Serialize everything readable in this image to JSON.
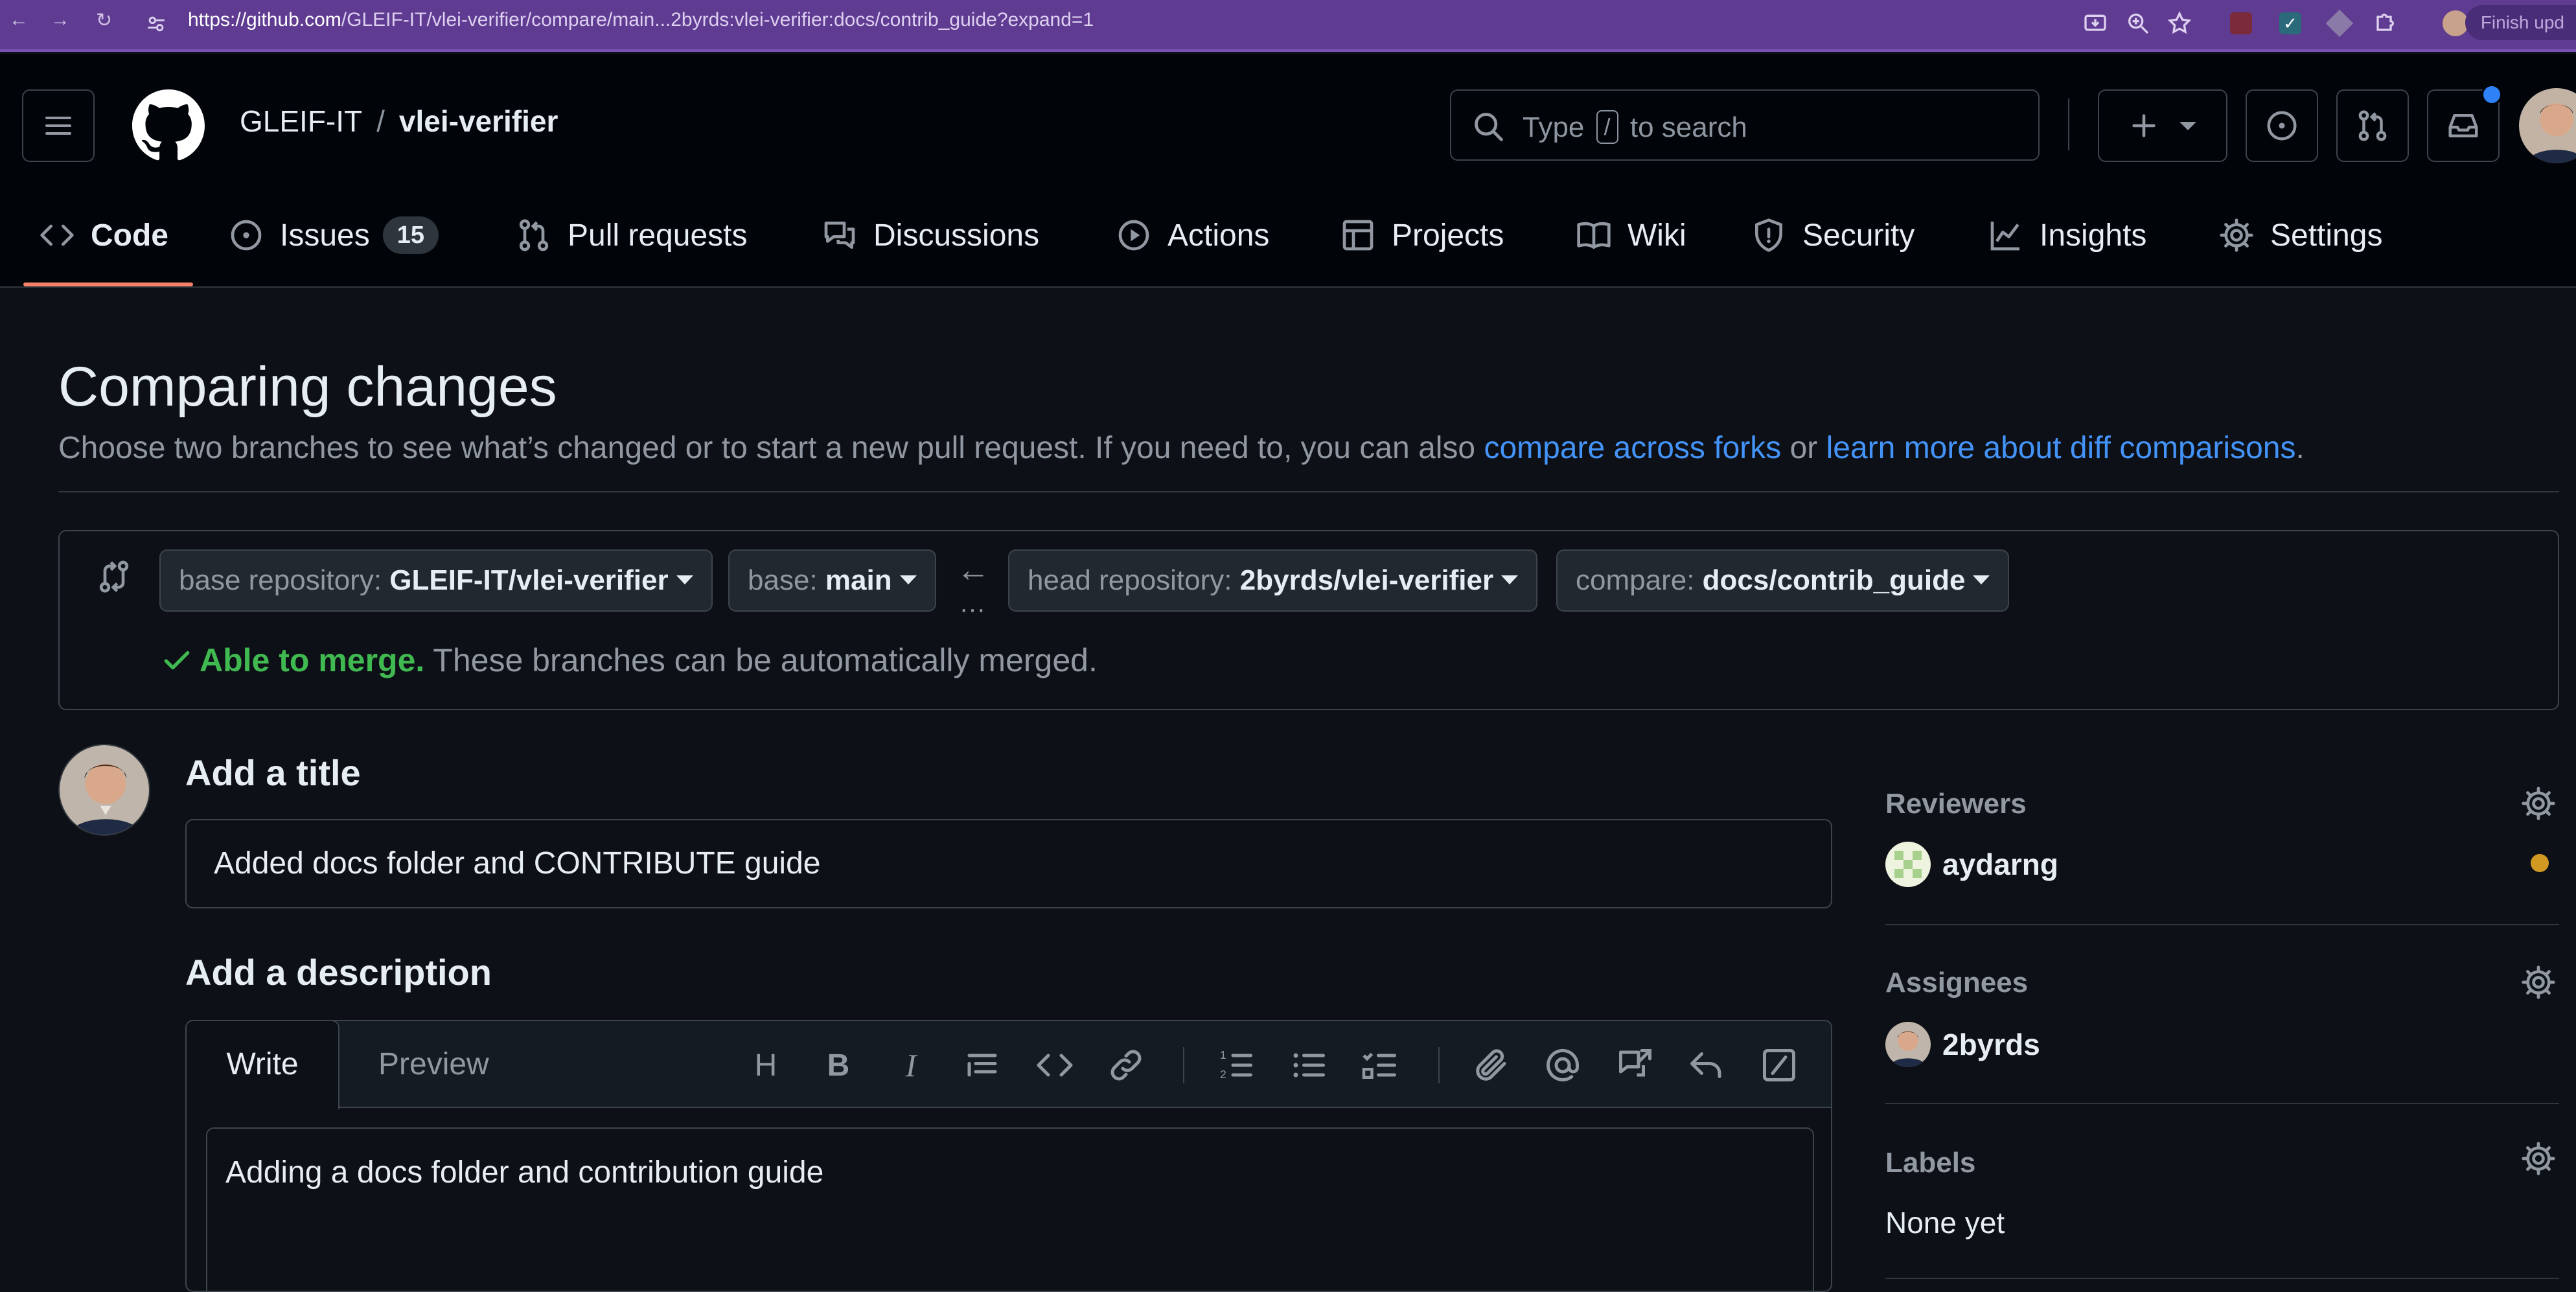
{
  "browser": {
    "url_host": "https://github.com",
    "url_path": "/GLEIF-IT/vlei-verifier/compare/main...2byrds:vlei-verifier:docs/contrib_guide?expand=1",
    "finish_update": "Finish upd"
  },
  "header": {
    "owner": "GLEIF-IT",
    "separator": "/",
    "repo": "vlei-verifier",
    "search_prefix": "Type",
    "search_key": "/",
    "search_suffix": "to search"
  },
  "repo_tabs": [
    {
      "label": "Code",
      "icon": "code-icon"
    },
    {
      "label": "Issues",
      "icon": "issue-opened-icon",
      "count": "15"
    },
    {
      "label": "Pull requests",
      "icon": "git-pull-request-icon"
    },
    {
      "label": "Discussions",
      "icon": "comment-discussion-icon"
    },
    {
      "label": "Actions",
      "icon": "play-icon"
    },
    {
      "label": "Projects",
      "icon": "table-icon"
    },
    {
      "label": "Wiki",
      "icon": "book-icon"
    },
    {
      "label": "Security",
      "icon": "shield-icon"
    },
    {
      "label": "Insights",
      "icon": "graph-icon"
    },
    {
      "label": "Settings",
      "icon": "gear-icon"
    }
  ],
  "compare": {
    "title": "Comparing changes",
    "subtitle_lead": "Choose two branches to see what’s changed or to start a new pull request. If you need to, you can also ",
    "link_forks": "compare across forks",
    "subtitle_or": " or ",
    "link_learn": "learn more about diff comparisons",
    "subtitle_end": ".",
    "base_repo_label": "base repository:",
    "base_repo_value": "GLEIF-IT/vlei-verifier",
    "base_label": "base:",
    "base_value": "main",
    "head_repo_label": "head repository:",
    "head_repo_value": "2byrds/vlei-verifier",
    "compare_label": "compare:",
    "compare_value": "docs/contrib_guide",
    "merge_ok": "Able to merge.",
    "merge_text": " These branches can be automatically merged."
  },
  "form": {
    "title_label": "Add a title",
    "title_value": "Added docs folder and CONTRIBUTE guide",
    "desc_label": "Add a description",
    "tab_write": "Write",
    "tab_preview": "Preview",
    "desc_value": "Adding a docs folder and contribution guide"
  },
  "sidebar": {
    "reviewers_label": "Reviewers",
    "reviewer": "aydarng",
    "assignees_label": "Assignees",
    "assignee": "2byrds",
    "labels_label": "Labels",
    "labels_value": "None yet"
  },
  "colors": {
    "accent_link": "#4493f8",
    "success": "#3fb950",
    "tab_underline": "#f78166",
    "pending": "#d29922",
    "browser_bar": "#5f3c91"
  }
}
